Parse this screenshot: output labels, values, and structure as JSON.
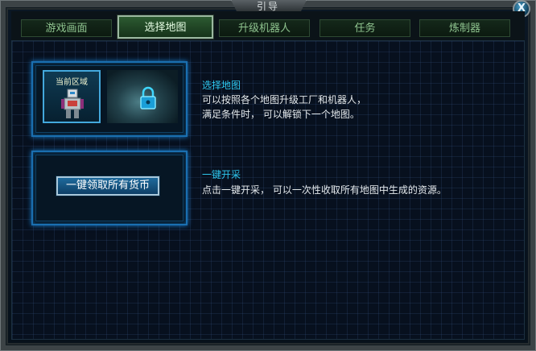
{
  "window": {
    "title": "引导",
    "close_label": "X"
  },
  "tabs": [
    {
      "label": "游戏画面",
      "active": false
    },
    {
      "label": "选择地图",
      "active": true
    },
    {
      "label": "升级机器人",
      "active": false
    },
    {
      "label": "任务",
      "active": false
    },
    {
      "label": "炼制器",
      "active": false
    }
  ],
  "sections": [
    {
      "image_label": "当前区域",
      "title": "选择地图",
      "lines": [
        "可以按照各个地图升级工厂和机器人，",
        "满足条件时，  可以解锁下一个地图。"
      ]
    },
    {
      "button_label": "一键领取所有货币",
      "title": "一键开采",
      "lines": [
        "点击一键开采，  可以一次性收取所有地图中生成的资源。"
      ]
    }
  ],
  "colors": {
    "accent": "#2ec8f0",
    "tab_active": "#2c5a31",
    "card_border": "#1a6fb0"
  },
  "icons": [
    "close-icon",
    "robot-icon",
    "lock-icon"
  ]
}
